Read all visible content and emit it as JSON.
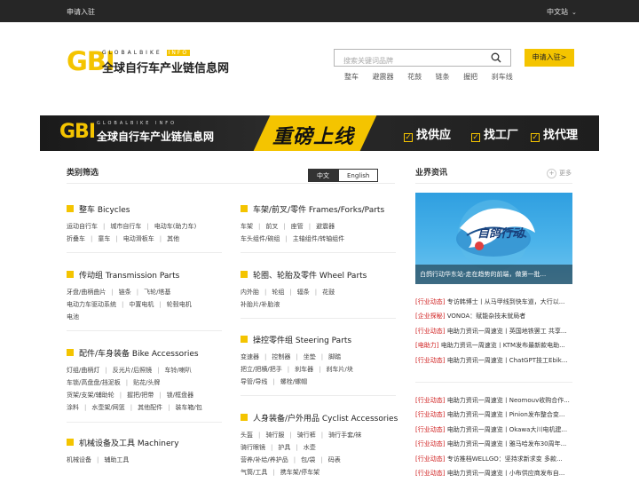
{
  "topbar": {
    "apply": "申请入驻",
    "lang": "中文站"
  },
  "logo": {
    "gbi": "GBI",
    "en_prefix": "GLOBALBIKE",
    "en_suffix": "INFO",
    "cn": "全球自行车产业链信息网"
  },
  "search": {
    "placeholder": "搜索关键词品牌",
    "apply_button": "申请入驻>"
  },
  "hotlinks": [
    "整车",
    "避震器",
    "花鼓",
    "链条",
    "握把",
    "刹车线"
  ],
  "banner": {
    "gbi": "GBI",
    "en": "GLOBALBIKE INFO",
    "cn": "全球自行车产业链信息网",
    "slogan": "重磅上线",
    "tags": [
      "找供应",
      "找工厂",
      "找代理"
    ]
  },
  "categories": {
    "title": "类别筛选",
    "lang_cn": "中文",
    "lang_en": "English",
    "left": [
      {
        "title": "整车 Bicycles",
        "links": [
          "运动自行车",
          "城市自行车",
          "电动车(助力车)",
          "折叠车",
          "童车",
          "电动滑板车",
          "其他"
        ]
      },
      {
        "title": "传动组 Transmission Parts",
        "links": [
          "牙盘/曲柄曲片",
          "链条",
          "飞轮/塔基",
          "电动力车驱动系统",
          "中置电机",
          "轮毂电机",
          "电池"
        ]
      },
      {
        "title": "配件/车身装备 Bike Accessories",
        "links": [
          "灯组/曲柄灯",
          "反光片/后照镜",
          "车铃/喇叭",
          "车锁/高盘盘/挡泥板",
          "贴花/头牌",
          "货架/支架/辅助轮",
          "握把/把带",
          "锁/框盘器",
          "涂料",
          "水壶架/网篮",
          "其他配件",
          "装车箱/包"
        ]
      },
      {
        "title": "机械设备及工具 Machinery",
        "links": [
          "机械设备",
          "辅助工具"
        ]
      }
    ],
    "right": [
      {
        "title": "车架/前叉/零件 Frames/Forks/Parts",
        "links": [
          "车架",
          "前叉",
          "座管",
          "避震器",
          "车头组件/碗组",
          "主轴组件/转轴组件"
        ]
      },
      {
        "title": "轮圈、轮胎及零件 Wheel Parts",
        "links": [
          "内外胎",
          "轮组",
          "辐条",
          "花鼓",
          "补胎片/补胎液"
        ]
      },
      {
        "title": "操控零件组 Steering Parts",
        "links": [
          "变速器",
          "控制器",
          "坐垫",
          "脚踏",
          "把立/把横/把手",
          "刹车器",
          "刹车片/块",
          "导管/导线",
          "螺栓/螺帽"
        ]
      },
      {
        "title": "人身装备/户外用品 Cyclist Accessories",
        "links": [
          "头盔",
          "骑行服",
          "骑行裤",
          "骑行手套/袜",
          "骑行眼镜",
          "护具",
          "水壶",
          "营养/补给/养护品",
          "包/袋",
          "码表",
          "气筒/工具",
          "携车架/停车架"
        ]
      }
    ]
  },
  "news": {
    "title": "业界资讯",
    "more": "更多",
    "feature": {
      "image_text": "自鸽行动",
      "caption": "白鸽行动华东站-走在趋势的前端，做第一批..."
    },
    "group1": [
      {
        "tag": "[行业动态]",
        "text": "专访韩博士丨从马甲线到快车道，大行以..."
      },
      {
        "tag": "[企业探秘]",
        "text": "VONOA：赋能杂技未就局者"
      },
      {
        "tag": "[行业动态]",
        "text": "电助力资讯一周速览丨英国地铁罢工 共享..."
      },
      {
        "tag": "[电助力]",
        "text": "电助力资讯一周速览丨KTM发布最新款电助..."
      },
      {
        "tag": "[行业动态]",
        "text": "电助力资讯一周速览丨ChatGPT技工Ebik..."
      }
    ],
    "group2": [
      {
        "tag": "[行业动态]",
        "text": "电助力资讯一周速览丨Neomouv收购合作..."
      },
      {
        "tag": "[行业动态]",
        "text": "电助力资讯一周速览丨Pinion发布整合变..."
      },
      {
        "tag": "[行业动态]",
        "text": "电助力资讯一周速览丨Okawa大川电机建..."
      },
      {
        "tag": "[行业动态]",
        "text": "电助力资讯一周速览丨雅马哈发布30周年..."
      },
      {
        "tag": "[行业动态]",
        "text": "专访推档WELLGO：坚持求新求变 多款..."
      },
      {
        "tag": "[行业动态]",
        "text": "电助力资讯一周速览丨小布供应商发布自..."
      }
    ]
  },
  "colors": {
    "accent": "#f4c400",
    "topbar": "#262626",
    "tag_red": "#d02020"
  }
}
